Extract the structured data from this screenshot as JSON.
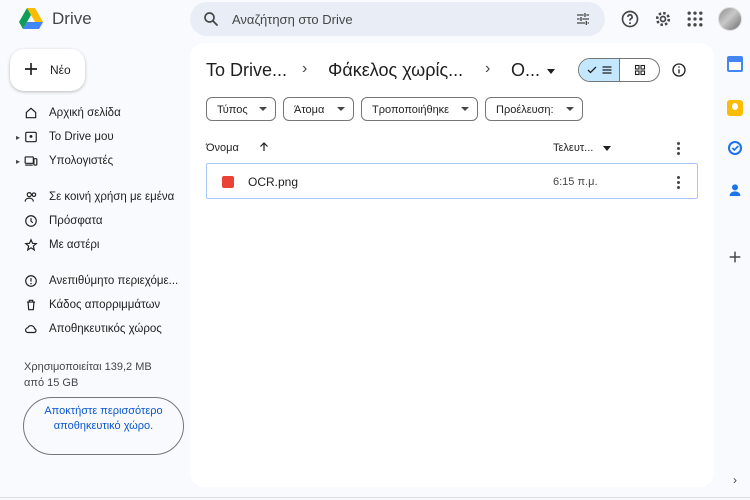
{
  "header": {
    "brand": "Drive",
    "search_placeholder": "Αναζήτηση στο Drive",
    "icons": [
      "search-icon",
      "tune-icon",
      "help-icon",
      "settings-icon",
      "apps-icon",
      "avatar"
    ]
  },
  "new_button": {
    "label": "Νέο"
  },
  "sidebar": {
    "items": [
      {
        "label": "Αρχική σελίδα",
        "icon": "home-icon"
      },
      {
        "label": "Το Drive μου",
        "icon": "my-drive-icon"
      },
      {
        "label": "Υπολογιστές",
        "icon": "computers-icon"
      },
      {
        "label": "Σε κοινή χρήση με εμένα",
        "icon": "shared-icon"
      },
      {
        "label": "Πρόσφατα",
        "icon": "clock-icon"
      },
      {
        "label": "Με αστέρι",
        "icon": "star-icon"
      },
      {
        "label": "Ανεπιθύμητο περιεχόμε...",
        "icon": "spam-icon"
      },
      {
        "label": "Κάδος απορριμμάτων",
        "icon": "trash-icon"
      },
      {
        "label": "Αποθηκευτικός χώρος",
        "icon": "cloud-icon"
      }
    ],
    "storage_line1": "Χρησιμοποιείται 139,2 MB",
    "storage_line2": "από 15 GB",
    "get_storage": "Αποκτήστε περισσότερο αποθηκευτικό χώρο."
  },
  "breadcrumb": {
    "root": "Το Drive...",
    "folder": "Φάκελος χωρίς...",
    "current": "Ο..."
  },
  "filters": [
    "Τύπος",
    "Άτομα",
    "Τροποποιήθηκε",
    "Προέλευση:"
  ],
  "table": {
    "col_name": "Όνομα",
    "col_modified": "Τελευτ...",
    "rows": [
      {
        "name": "OCR.png",
        "modified": "6:15 π.μ."
      }
    ]
  },
  "colors": {
    "accent": "#0b57d0",
    "toggle_selected": "#c2e7ff",
    "image_file": "#ea4335"
  }
}
